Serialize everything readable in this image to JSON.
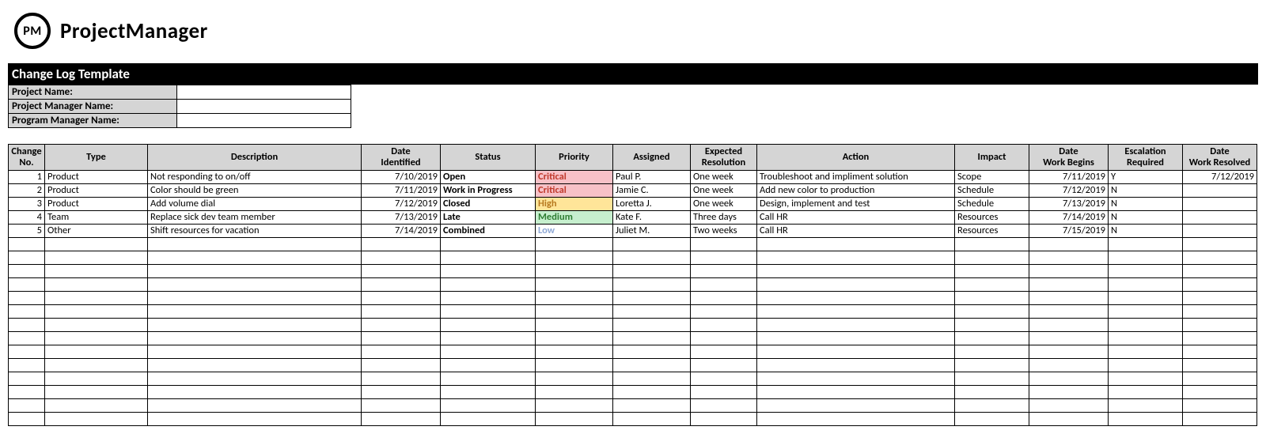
{
  "brand": {
    "logo_text": "PM",
    "name": "ProjectManager"
  },
  "title": "Change Log Template",
  "info_labels": {
    "project_name": "Project Name:",
    "project_manager": "Project Manager Name:",
    "program_manager": "Program Manager Name:"
  },
  "info_values": {
    "project_name": "",
    "project_manager": "",
    "program_manager": ""
  },
  "headers": {
    "change_no": "Change\nNo.",
    "type": "Type",
    "description": "Description",
    "date_identified": "Date\nIdentified",
    "status": "Status",
    "priority": "Priority",
    "assigned": "Assigned",
    "expected_resolution": "Expected\nResolution",
    "action": "Action",
    "impact": "Impact",
    "date_work_begins": "Date\nWork Begins",
    "escalation_required": "Escalation\nRequired",
    "date_work_resolved": "Date\nWork Resolved"
  },
  "rows": [
    {
      "no": "1",
      "type": "Product",
      "description": "Not responding to on/off",
      "date_identified": "7/10/2019",
      "status": "Open",
      "priority": "Critical",
      "assigned": "Paul P.",
      "expected": "One week",
      "action": "Troubleshoot and impliment solution",
      "impact": "Scope",
      "date_begins": "7/11/2019",
      "escalation": "Y",
      "date_resolved": "7/12/2019"
    },
    {
      "no": "2",
      "type": "Product",
      "description": "Color should be green",
      "date_identified": "7/11/2019",
      "status": "Work in Progress",
      "priority": "Critical",
      "assigned": "Jamie C.",
      "expected": "One week",
      "action": "Add new color to production",
      "impact": "Schedule",
      "date_begins": "7/12/2019",
      "escalation": "N",
      "date_resolved": ""
    },
    {
      "no": "3",
      "type": "Product",
      "description": "Add volume dial",
      "date_identified": "7/12/2019",
      "status": "Closed",
      "priority": "High",
      "assigned": "Loretta J.",
      "expected": "One week",
      "action": "Design, implement and test",
      "impact": "Schedule",
      "date_begins": "7/13/2019",
      "escalation": "N",
      "date_resolved": ""
    },
    {
      "no": "4",
      "type": "Team",
      "description": "Replace sick dev team member",
      "date_identified": "7/13/2019",
      "status": "Late",
      "priority": "Medium",
      "assigned": "Kate F.",
      "expected": "Three days",
      "action": "Call HR",
      "impact": "Resources",
      "date_begins": "7/14/2019",
      "escalation": "N",
      "date_resolved": ""
    },
    {
      "no": "5",
      "type": "Other",
      "description": "Shift resources for vacation",
      "date_identified": "7/14/2019",
      "status": "Combined",
      "priority": "Low",
      "assigned": "Juliet M.",
      "expected": "Two weeks",
      "action": "Call HR",
      "impact": "Resources",
      "date_begins": "7/15/2019",
      "escalation": "N",
      "date_resolved": ""
    }
  ],
  "empty_rows": 14
}
